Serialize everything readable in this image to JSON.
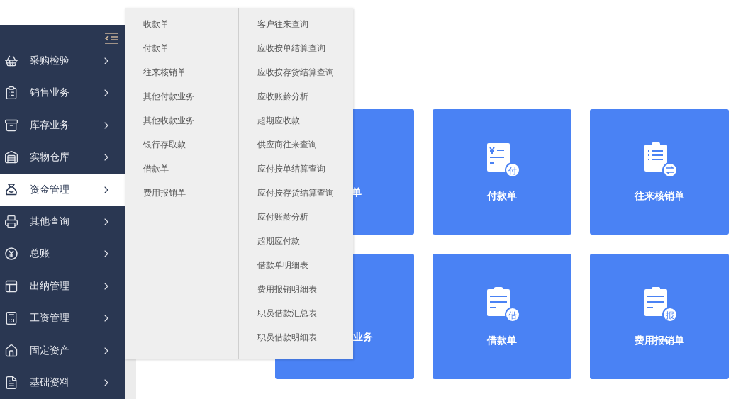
{
  "sidebar": {
    "items": [
      {
        "label": "采购检验",
        "selected": false
      },
      {
        "label": "销售业务",
        "selected": false
      },
      {
        "label": "库存业务",
        "selected": false
      },
      {
        "label": "实物仓库",
        "selected": false
      },
      {
        "label": "资金管理",
        "selected": true
      },
      {
        "label": "其他查询",
        "selected": false
      },
      {
        "label": "总账",
        "selected": false
      },
      {
        "label": "出纳管理",
        "selected": false
      },
      {
        "label": "工资管理",
        "selected": false
      },
      {
        "label": "固定资产",
        "selected": false
      },
      {
        "label": "基础资料",
        "selected": false
      }
    ]
  },
  "flyout": {
    "columns": [
      [
        "收款单",
        "付款单",
        "往来核销单",
        "其他付款业务",
        "其他收款业务",
        "银行存取款",
        "借款单",
        "费用报销单"
      ],
      [
        "客户往来查询",
        "应收按单结算查询",
        "应收按存货结算查询",
        "应收账龄分析",
        "超期应收款",
        "供应商往来查询",
        "应付按单结算查询",
        "应付按存货结算查询",
        "应付账龄分析",
        "超期应付款",
        "借款单明细表",
        "费用报销明细表",
        "职员借款汇总表",
        "职员借款明细表"
      ]
    ]
  },
  "tiles": [
    {
      "kind": "covered",
      "label": "单"
    },
    {
      "kind": "bill",
      "label": "付款单",
      "badge": "付"
    },
    {
      "kind": "list",
      "label": "往来核销单"
    },
    {
      "kind": "covered",
      "label": "业务"
    },
    {
      "kind": "clipboard",
      "label": "借款单",
      "badge": "借"
    },
    {
      "kind": "clipboard",
      "label": "费用报销单",
      "badge": "报"
    }
  ]
}
